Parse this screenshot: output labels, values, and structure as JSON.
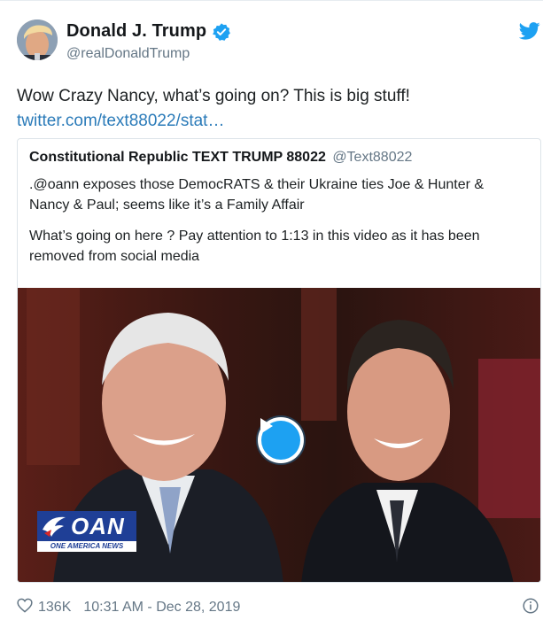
{
  "author": {
    "display_name": "Donald J. Trump",
    "handle": "@realDonaldTrump",
    "verified": true
  },
  "tweet": {
    "text": "Wow Crazy Nancy, what’s going on? This is big stuff!",
    "link": "twitter.com/text88022/stat…"
  },
  "quoted_tweet": {
    "display_name": "Constitutional Republic TEXT TRUMP 88022",
    "handle": "@Text88022",
    "paragraph_1": ".@oann exposes those DemocRATS & their Ukraine ties Joe & Hunter & Nancy & Paul; seems like it’s a Family Affair",
    "paragraph_2": "What’s going on here ? Pay attention to 1:13 in this video as it has been removed from social media",
    "media": {
      "type": "video",
      "logo_text": "OAN",
      "logo_subtext": "ONE AMERICA NEWS"
    }
  },
  "footer": {
    "likes": "136K",
    "timestamp": "10:31 AM - Dec 28, 2019"
  },
  "icons": [
    "verified-badge-icon",
    "twitter-bird-icon",
    "play-icon",
    "heart-icon",
    "info-icon"
  ],
  "colors": {
    "twitter_blue": "#1da1f2",
    "link_blue": "#2b7bb9",
    "muted_text": "#657786",
    "oan_blue": "#1f3f96"
  }
}
